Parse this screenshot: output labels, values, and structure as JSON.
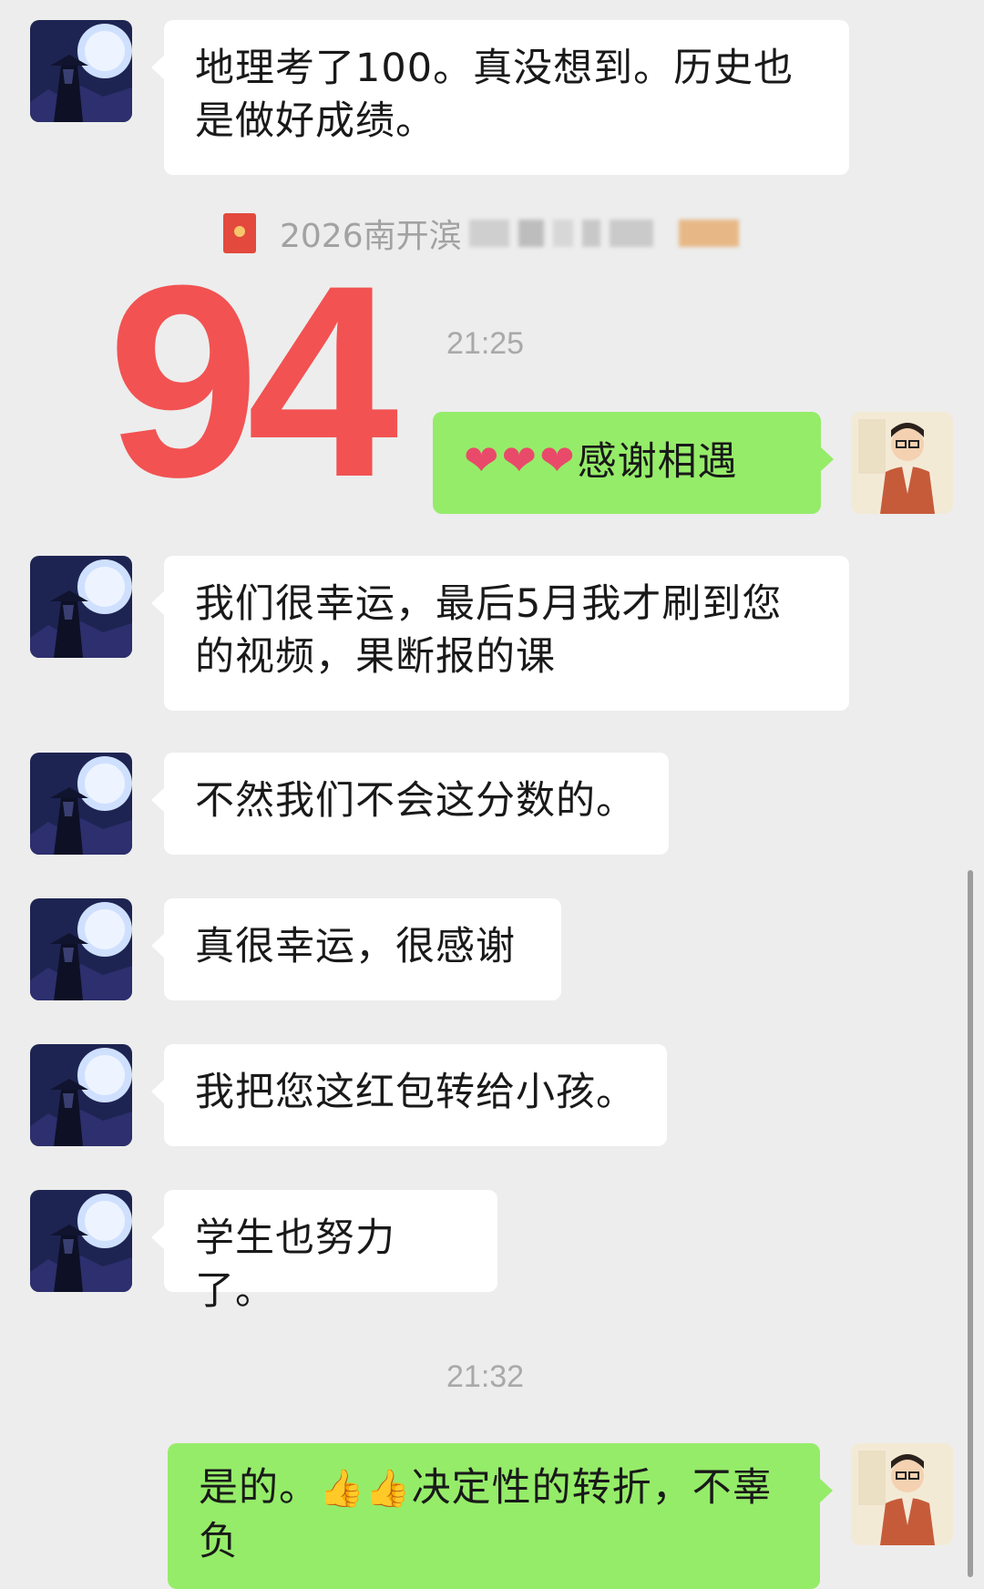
{
  "messages": [
    {
      "side": "left",
      "text": "地理考了100。真没想到。历史也是做好成绩。"
    },
    {
      "side": "right",
      "text": "感谢相遇",
      "prefix_icons": [
        "heart-icon",
        "heart-icon",
        "heart-icon"
      ]
    },
    {
      "side": "left",
      "text": "我们很幸运，最后5月我才刷到您的视频，果断报的课"
    },
    {
      "side": "left",
      "text": "不然我们不会这分数的。"
    },
    {
      "side": "left",
      "text": "真很幸运，很感谢"
    },
    {
      "side": "left",
      "text": "我把您这红包转给小孩。"
    },
    {
      "side": "left",
      "text": "学生也努力了。"
    },
    {
      "side": "right",
      "text_before": "是的。",
      "text_after": "决定性的转折，不辜负",
      "inline_icons": [
        "thumbs-up-icon",
        "thumbs-up-icon"
      ]
    }
  ],
  "system_note": {
    "text": "2026南开滨",
    "icon": "red-packet-icon"
  },
  "score_overlay": "94",
  "timestamps": [
    "21:25",
    "21:32"
  ],
  "colors": {
    "background": "#ededed",
    "incoming_bubble": "#ffffff",
    "outgoing_bubble": "#95ec69",
    "score": "#f25252",
    "timestamp": "#a9a9a9"
  }
}
